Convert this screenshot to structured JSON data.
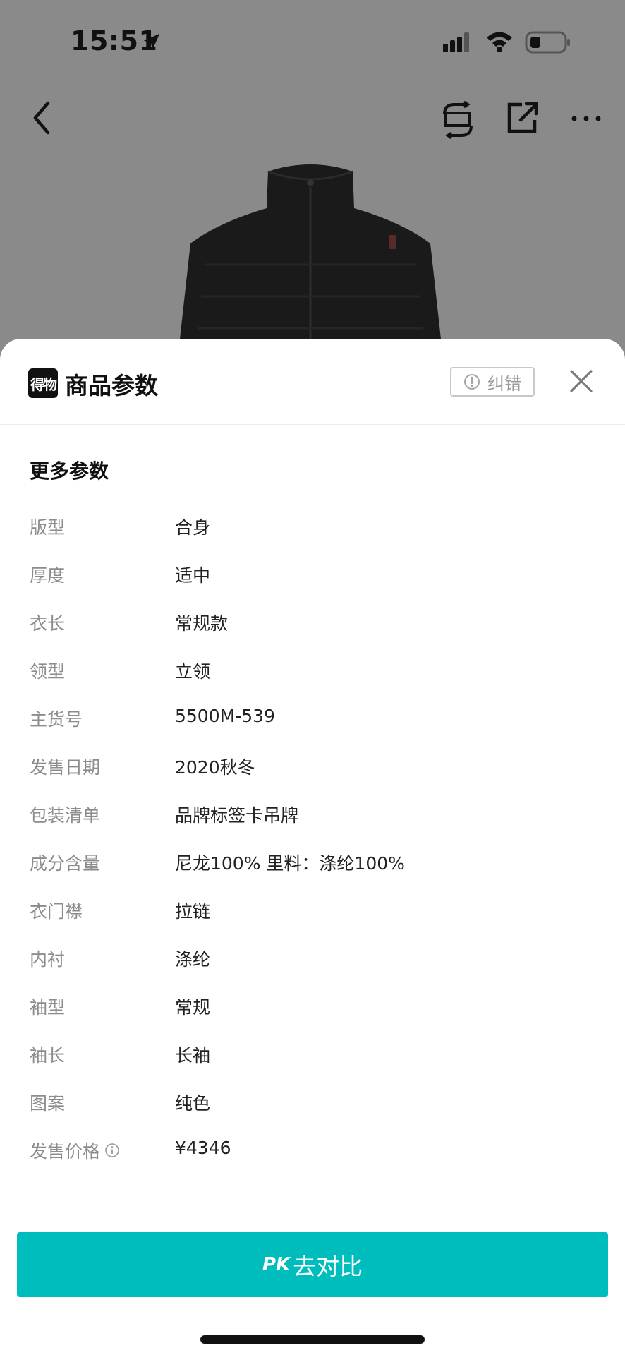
{
  "status_bar": {
    "time": "15:51",
    "icons": [
      "location-arrow-icon",
      "signal-icon",
      "wifi-icon",
      "battery-icon"
    ]
  },
  "nav": {
    "icons": [
      "back-icon",
      "sell-icon",
      "share-icon",
      "more-icon"
    ]
  },
  "sheet": {
    "brand_logo": "得物",
    "title": "商品参数",
    "correct_label": "纠错",
    "section_title": "更多参数",
    "params": [
      {
        "label": "版型",
        "value": "合身"
      },
      {
        "label": "厚度",
        "value": "适中"
      },
      {
        "label": "衣长",
        "value": "常规款"
      },
      {
        "label": "领型",
        "value": "立领"
      },
      {
        "label": "主货号",
        "value": "5500M-539"
      },
      {
        "label": "发售日期",
        "value": "2020秋冬"
      },
      {
        "label": "包装清单",
        "value": "品牌标签卡吊牌"
      },
      {
        "label": "成分含量",
        "value": "尼龙100% 里料：涤纶100%"
      },
      {
        "label": "衣门襟",
        "value": "拉链"
      },
      {
        "label": "内衬",
        "value": "涤纶"
      },
      {
        "label": "袖型",
        "value": "常规"
      },
      {
        "label": "袖长",
        "value": "长袖"
      },
      {
        "label": "图案",
        "value": "纯色"
      },
      {
        "label": "发售价格",
        "value": "¥4346"
      }
    ]
  },
  "pk_button": {
    "tag": "PK",
    "label": "去对比",
    "color": "#00bdbd"
  }
}
